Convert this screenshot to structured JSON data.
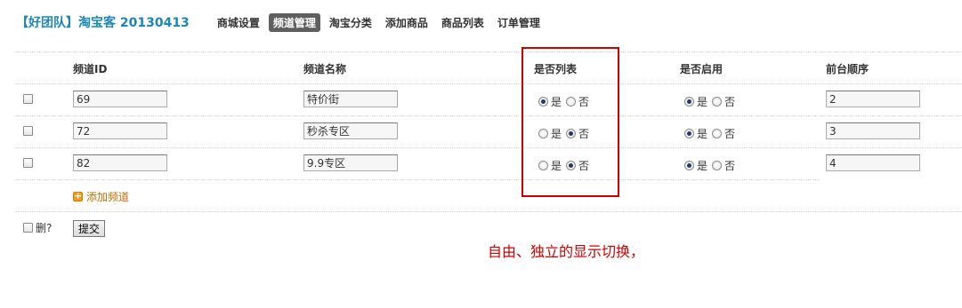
{
  "header": {
    "brand": "【好团队】淘宝客 20130413",
    "nav": [
      "商城设置",
      "频道管理",
      "淘宝分类",
      "添加商品",
      "商品列表",
      "订单管理"
    ],
    "active_index": 1
  },
  "table": {
    "columns": [
      "频道ID",
      "频道名称",
      "是否列表",
      "是否启用",
      "前台顺序"
    ],
    "yes_label": "是",
    "no_label": "否",
    "rows": [
      {
        "id": "69",
        "name": "特价街",
        "is_list": "yes",
        "enabled": "yes",
        "order": "2"
      },
      {
        "id": "72",
        "name": "秒杀专区",
        "is_list": "no",
        "enabled": "yes",
        "order": "3"
      },
      {
        "id": "82",
        "name": "9.9专区",
        "is_list": "no",
        "enabled": "yes",
        "order": "4"
      }
    ]
  },
  "actions": {
    "add_channel": "添加频道",
    "delete_label": "删?",
    "submit": "提交"
  },
  "annotation": {
    "note": "自由、独立的显示切换，",
    "color": "#d10000"
  }
}
